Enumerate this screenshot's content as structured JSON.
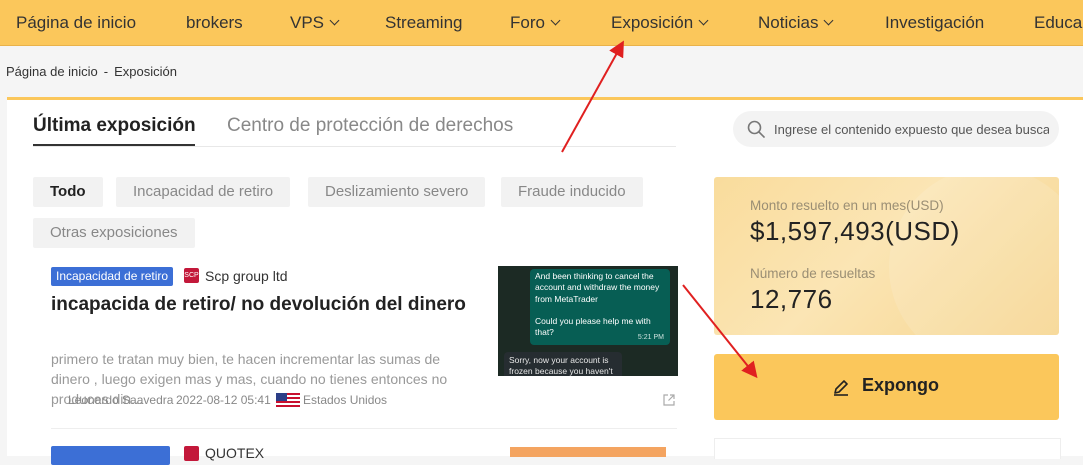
{
  "nav": {
    "items": [
      {
        "label": "Página de inicio"
      },
      {
        "label": "brokers"
      },
      {
        "label": "VPS"
      },
      {
        "label": "Streaming"
      },
      {
        "label": "Foro"
      },
      {
        "label": "Exposición"
      },
      {
        "label": "Noticias"
      },
      {
        "label": "Investigación"
      },
      {
        "label": "Educac"
      }
    ]
  },
  "breadcrumb": {
    "home": "Página de inicio",
    "separator": "-",
    "current": "Exposición"
  },
  "tabs": {
    "active": "Última exposición",
    "inactive": "Centro de protección de derechos"
  },
  "search": {
    "placeholder": "Ingrese el contenido expuesto que desea buscar"
  },
  "filters": [
    "Todo",
    "Incapacidad de retiro",
    "Deslizamiento severo",
    "Fraude inducido",
    "Otras exposiciones"
  ],
  "post": {
    "badge": "Incapacidad de retiro",
    "broker": "Scp group ltd",
    "broker_logo_text": "SCP",
    "title": "incapacida de retiro/ no devolución del dinero",
    "excerpt": "primero te tratan muy bien, te hacen incrementar las sumas de dinero , luego exigen mas y mas, cuando no tienes entonces no produces din...",
    "author": "Leonardo Saavedra",
    "datetime": "2022-08-12 05:41",
    "country": "Estados Unidos",
    "thumbnail": {
      "msg_out": "And been thinking to cancel the account and withdraw the money from MetaTrader",
      "msg_out2": "Could you please help me with that?",
      "msg_time": "5:21 PM",
      "msg_in": "Sorry, now your account is frozen because you haven't"
    }
  },
  "next_post": {
    "broker": "QUOTEX"
  },
  "stats": {
    "monthly_label": "Monto resuelto en un mes(USD)",
    "monthly_value": "$1,597,493(USD)",
    "count_label": "Número de resueltas",
    "count_value": "12,776"
  },
  "expose_button": {
    "label": "Expongo"
  },
  "colors": {
    "nav_bg": "#fbc75b",
    "badge_blue": "#3c6fd6",
    "arrow_red": "#e02020",
    "broker_red": "#c3183a"
  }
}
